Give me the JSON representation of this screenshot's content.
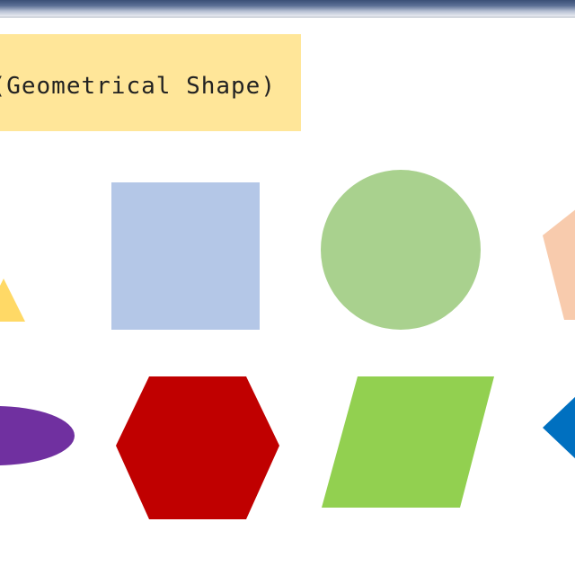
{
  "window": {
    "titlebar": ""
  },
  "slide": {
    "title": "n (Geometrical Shape)"
  },
  "shapes": [
    {
      "name": "triangle",
      "color": "#ffd966"
    },
    {
      "name": "square",
      "color": "#b4c7e7"
    },
    {
      "name": "circle",
      "color": "#a9d18e"
    },
    {
      "name": "pentagon",
      "color": "#f8cbad"
    },
    {
      "name": "oval",
      "color": "#7030a0"
    },
    {
      "name": "hexagon",
      "color": "#c00000"
    },
    {
      "name": "parallelogram",
      "color": "#92d050"
    },
    {
      "name": "diamond",
      "color": "#0070c0"
    }
  ]
}
